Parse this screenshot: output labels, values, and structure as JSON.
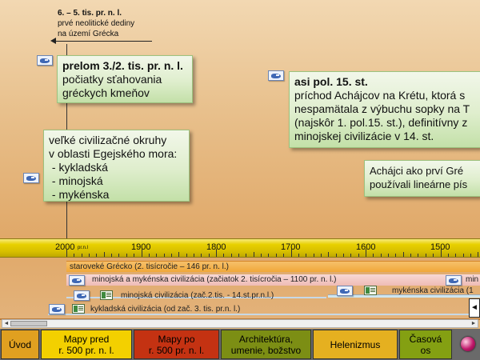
{
  "top_note": {
    "title": "6. – 5. tis. pr. n. l.",
    "line1": "prvé neolitické dediny",
    "line2": "na území Grécka"
  },
  "box_prelom": {
    "title": "prelom 3./2. tis. pr. n. l.",
    "line1": "počiatky sťahovania",
    "line2": "gréckych kmeňov"
  },
  "box_okruhy": {
    "line1": "veľké civilizačné okruhy",
    "line2": "v oblasti Egejského mora:",
    "item1": " - kykladská",
    "item2": " - minojská",
    "item3": " - mykénska"
  },
  "box_kreta": {
    "title": "asi pol. 15. st.",
    "line1": "príchod Achájcov na Krétu, ktorá s",
    "line2": "nespamätala z výbuchu sopky na T",
    "line3": "(najskôr 1. pol.15. st.), definitívny z",
    "line4": "minojskej civilizácie v 14. st."
  },
  "box_linear": {
    "line1": "Achájci ako prví Gré",
    "line2": "používali lineárne pís"
  },
  "ruler": {
    "label_2000": "2000",
    "label_prnl": "pr.n.l",
    "label_1900": "1900",
    "label_1800": "1800",
    "label_1700": "1700",
    "label_1600": "1600",
    "label_1500": "1500"
  },
  "bars": {
    "grecko": "staroveké Grécko (2. tisícročie – 146 pr. n. l.)",
    "minojska_mykenska": "minojská a mykénska civilizácia (začiatok 2. tisícročia – 1100 pr. n. l.)",
    "minojska_mykenska_cut": "min",
    "minojska": "minojská civilizácia (zač.2.tis. - 14.st.pr.n.l.)",
    "mykenska": "mykénska civilizácia (1",
    "kykladska": "kykladská civilizácia (od zač. 3. tis. pr.n. l.)",
    "nav_arrow": "◄"
  },
  "scrollbar": {
    "left": "◄",
    "right": "►"
  },
  "nav": {
    "uvod": "Úvod",
    "mapy_pred": "Mapy pred\nr. 500 pr. n. l.",
    "mapy_po": "Mapy po\nr. 500 pr. n. l.",
    "architektura": "Architektúra,\numenie, božstvo",
    "helenizmus": "Helenizmus",
    "casova_os": "Časová\nos"
  },
  "colors": {
    "nav_uvod": "#e0a020",
    "nav_mapy_pred": "#f3d000",
    "nav_mapy_po": "#c43212",
    "nav_architektura": "#7c8e14",
    "nav_helenizmus": "#e5b020",
    "nav_casova_os": "#84a012",
    "bar_grecko": "#f0a83a",
    "bar_minojska_mykenska": "#f2c4c0"
  }
}
